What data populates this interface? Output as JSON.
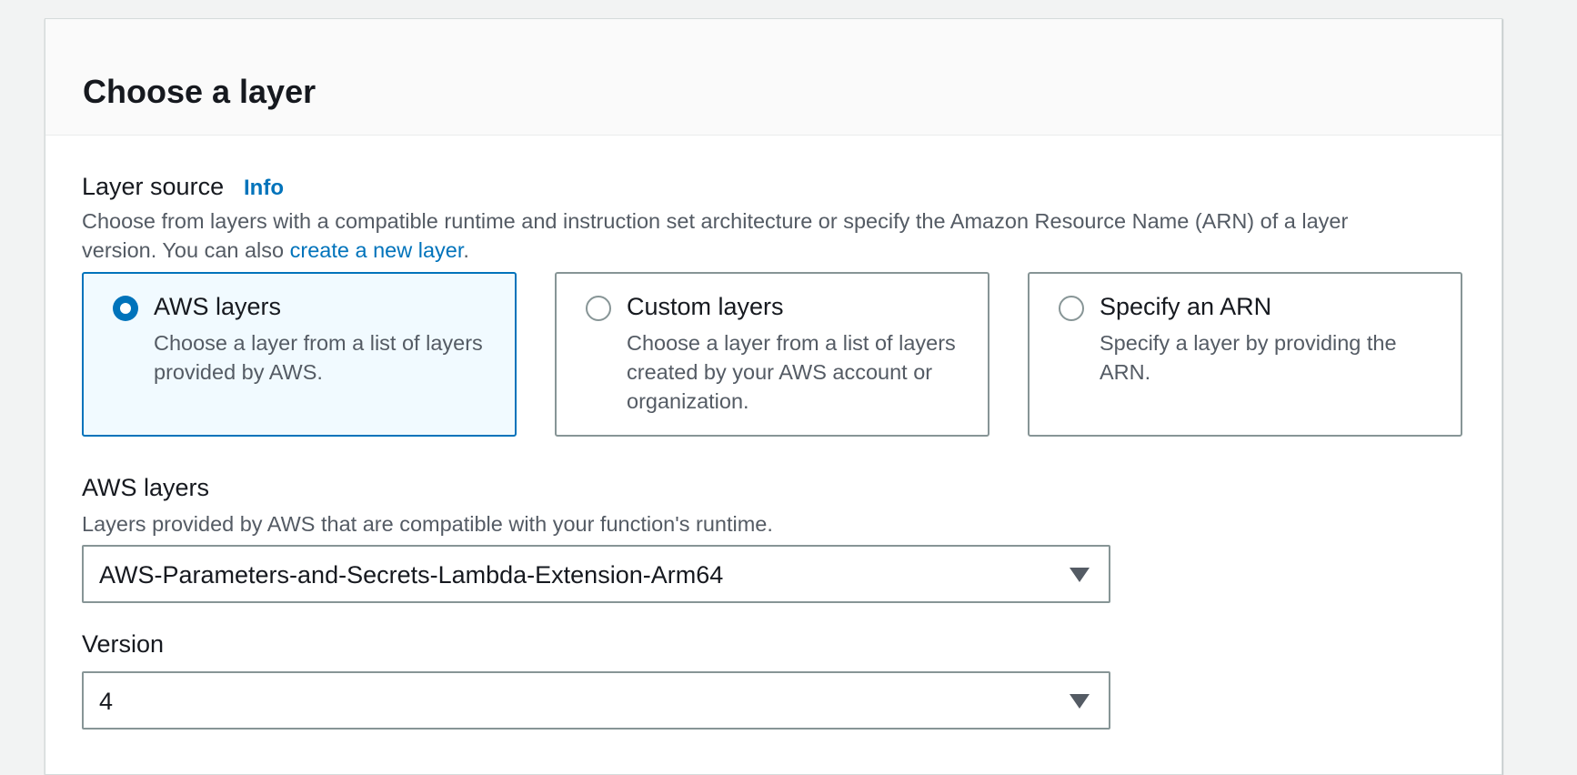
{
  "panel": {
    "title": "Choose a layer"
  },
  "layer_source": {
    "label": "Layer source",
    "info_link": "Info",
    "description_before_link": "Choose from layers with a compatible runtime and instruction set architecture or specify the Amazon Resource Name (ARN) of a layer version. You can also ",
    "description_link": "create a new layer",
    "description_after_link": ".",
    "options": [
      {
        "title": "AWS layers",
        "description": "Choose a layer from a list of layers provided by AWS.",
        "selected": true
      },
      {
        "title": "Custom layers",
        "description": "Choose a layer from a list of layers created by your AWS account or organization.",
        "selected": false
      },
      {
        "title": "Specify an ARN",
        "description": "Specify a layer by providing the ARN.",
        "selected": false
      }
    ]
  },
  "aws_layers": {
    "label": "AWS layers",
    "description": "Layers provided by AWS that are compatible with your function's runtime.",
    "selected_value": "AWS-Parameters-and-Secrets-Lambda-Extension-Arm64",
    "icon": "caret-down-icon"
  },
  "version": {
    "label": "Version",
    "selected_value": "4",
    "icon": "caret-down-icon"
  },
  "colors": {
    "accent": "#0073bb",
    "selected_tile_bg": "#f1faff",
    "border": "#879596",
    "text": "#16191f",
    "secondary_text": "#545b64"
  }
}
